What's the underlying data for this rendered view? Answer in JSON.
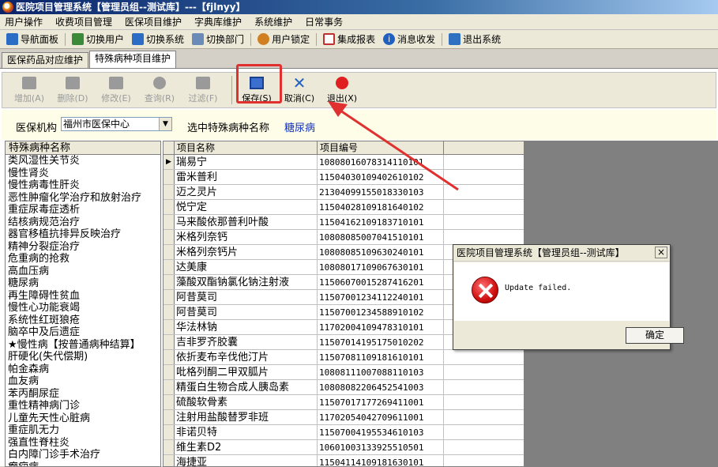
{
  "window": {
    "title": "医院项目管理系统【管理员组--测试库】---【fjlnyy】"
  },
  "menu": [
    "用户操作",
    "收费项目管理",
    "医保项目维护",
    "字典库维护",
    "系统维护",
    "日常事务"
  ],
  "nav": [
    {
      "label": "导航面板",
      "icon": "navigation-panel-icon",
      "color": "#2b6cc4"
    },
    {
      "label": "切换用户",
      "icon": "switch-user-icon",
      "color": "#3a8a3a"
    },
    {
      "label": "切换系统",
      "icon": "switch-system-icon",
      "color": "#2b6cc4"
    },
    {
      "label": "切换部门",
      "icon": "switch-department-icon",
      "color": "#6a8ab8"
    },
    {
      "label": "用户锁定",
      "icon": "user-lock-icon",
      "color": "#d08020"
    },
    {
      "label": "集成报表",
      "icon": "report-icon",
      "color": "#c03030"
    },
    {
      "label": "消息收发",
      "icon": "message-info-icon",
      "color": "#2060c0"
    },
    {
      "label": "退出系统",
      "icon": "exit-system-icon",
      "color": "#3070c0"
    }
  ],
  "tabs": [
    "医保药品对应维护",
    "特殊病种项目维护"
  ],
  "toolbar": {
    "add": "增加(A)",
    "delete": "删除(D)",
    "modify": "修改(E)",
    "query": "查询(R)",
    "filter": "过滤(F)",
    "save": "保存(S)",
    "cancel": "取消(C)",
    "exit": "退出(X)"
  },
  "info": {
    "org_label": "医保机构",
    "org_value": "福州市医保中心",
    "selected_label": "选中特殊病种名称",
    "selected_value": "糖尿病"
  },
  "left_list": {
    "header": "特殊病种名称",
    "items": [
      "类风湿性关节炎",
      "慢性肾炎",
      "慢性病毒性肝炎",
      "恶性肿瘤化学治疗和放射治疗",
      "重症尿毒症透析",
      "结核病规范治疗",
      "器官移植抗排异反映治疗",
      "精神分裂症治疗",
      "危重病的抢救",
      "高血压病",
      "糖尿病",
      "再生障碍性贫血",
      "慢性心功能衰竭",
      "系统性红斑狼疮",
      "脑卒中及后遗症",
      "★慢性病【按普通病种结算】",
      "肝硬化(失代偿期)",
      "帕金森病",
      "血友病",
      "苯丙酮尿症",
      "重性精神病门诊",
      "儿童先天性心脏病",
      "重症肌无力",
      "强直性脊柱炎",
      "白内障门诊手术治疗",
      "癫痫病"
    ]
  },
  "grid": {
    "col_name": "项目名称",
    "col_code": "项目编号",
    "rows": [
      {
        "name": "瑞易宁",
        "code": "10808016078314110101"
      },
      {
        "name": "雷米普利",
        "code": "11504030109402610102"
      },
      {
        "name": "迈之灵片",
        "code": "21304099155018330103"
      },
      {
        "name": "悦宁定",
        "code": "11504028109181640102"
      },
      {
        "name": "马来酸依那普利叶酸",
        "code": "11504162109183710101"
      },
      {
        "name": "米格列奈钙",
        "code": "10808085007041510101"
      },
      {
        "name": "米格列奈钙片",
        "code": "10808085109630240101"
      },
      {
        "name": "达美康",
        "code": "10808017109067630101"
      },
      {
        "name": "藻酸双酯钠氯化钠注射液",
        "code": "11506070015287416201"
      },
      {
        "name": "阿昔莫司",
        "code": "11507001234112240101"
      },
      {
        "name": "阿昔莫司",
        "code": "11507001234588910102"
      },
      {
        "name": "华法林钠",
        "code": "11702004109478310101"
      },
      {
        "name": "吉非罗齐胶囊",
        "code": "11507014195175010202"
      },
      {
        "name": "依折麦布辛伐他汀片",
        "code": "11507081109181610101"
      },
      {
        "name": "吡格列酮二甲双胍片",
        "code": "10808111007088110103"
      },
      {
        "name": "精蛋白生物合成人胰岛素",
        "code": "10808082206452541003"
      },
      {
        "name": "硫酸软骨素",
        "code": "11507017177269411001"
      },
      {
        "name": "注射用盐酸替罗非班",
        "code": "11702054042709611001"
      },
      {
        "name": "非诺贝特",
        "code": "11507004195534610103"
      },
      {
        "name": "维生素D2",
        "code": "10601003133925510501"
      },
      {
        "name": "海捷亚",
        "code": "11504114109181630101"
      }
    ]
  },
  "dialog": {
    "title": "医院项目管理系统【管理员组--测试库】",
    "message": "Update failed.",
    "ok": "确定",
    "close": "×"
  },
  "annotation": {
    "color": "#e03030"
  }
}
